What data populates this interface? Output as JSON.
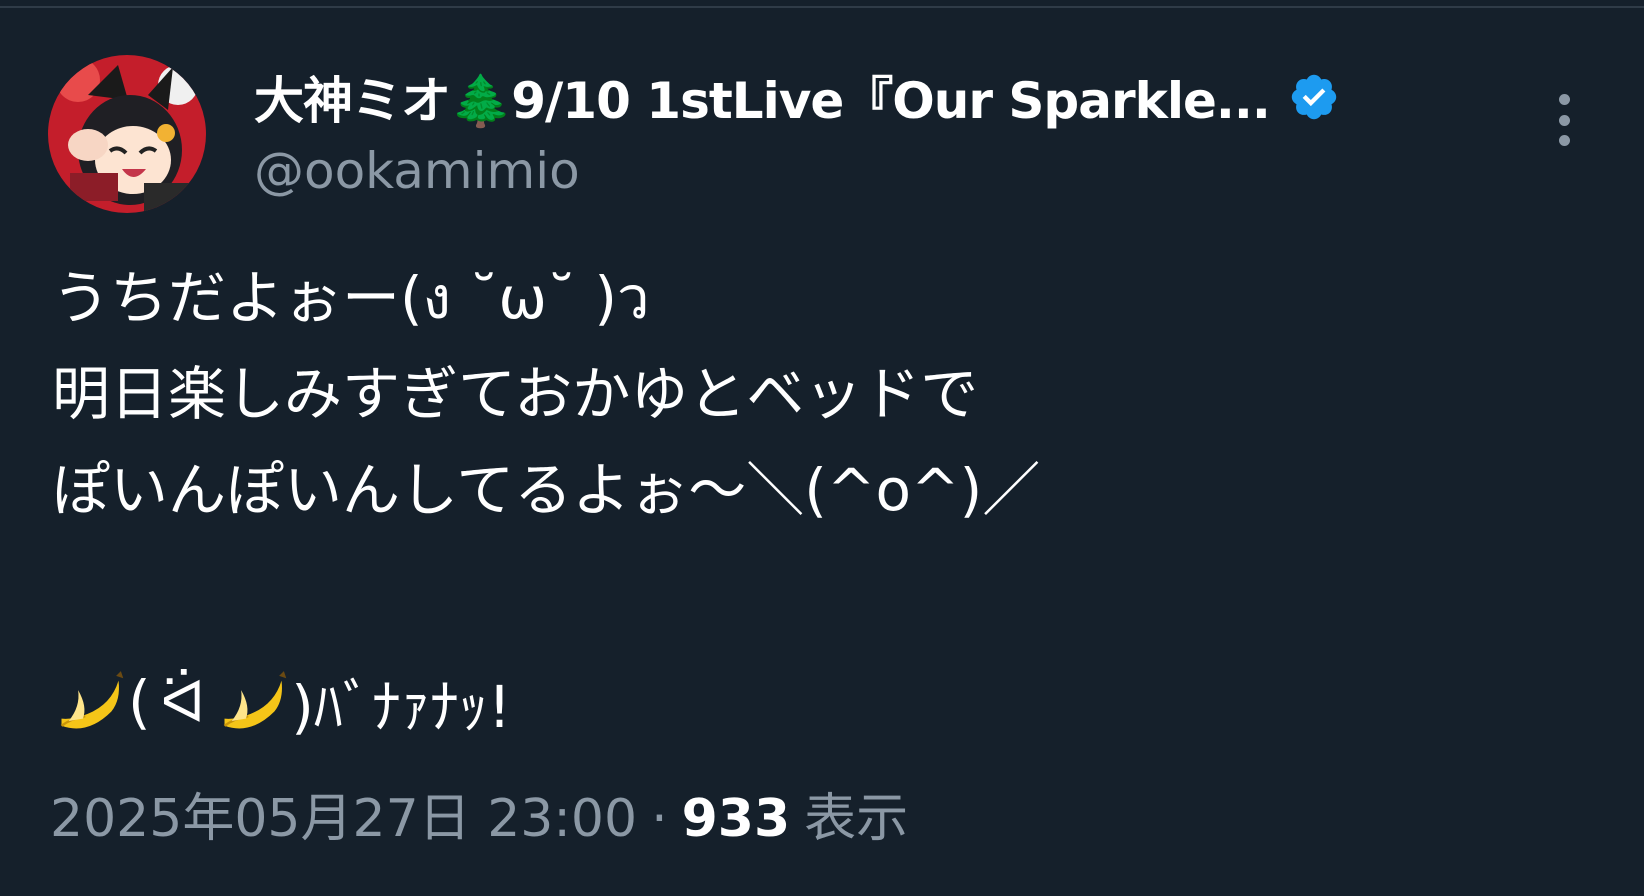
{
  "tweet": {
    "author": {
      "display_name": "大神ミオ🌲9/10 1stLive『Our Sparkle...",
      "handle": "@ookamimio",
      "verified": true,
      "avatar": "avatar-illustration"
    },
    "body_lines": [
      "うちだよぉー(ง ˘ω˘ )ว",
      "明日楽しみすぎておかゆとベッドで",
      "ぽいんぽいんしてるよぉ～＼(^o^)／"
    ],
    "banana_line": {
      "open": "(",
      "face": "ᐛ",
      "close_text": ")ﾊﾞﾅｧﾅｯ!",
      "icon": "banana-icon"
    },
    "timestamp": "2025年05月27日 23:00",
    "separator": "·",
    "views_count": "933",
    "views_label": "表示"
  },
  "icons": {
    "verified": "verified-badge-icon",
    "more": "more-options-icon"
  },
  "colors": {
    "background": "#15202b",
    "text_primary": "#ffffff",
    "text_secondary": "#8b98a5",
    "verified_blue": "#1d9bf0"
  }
}
